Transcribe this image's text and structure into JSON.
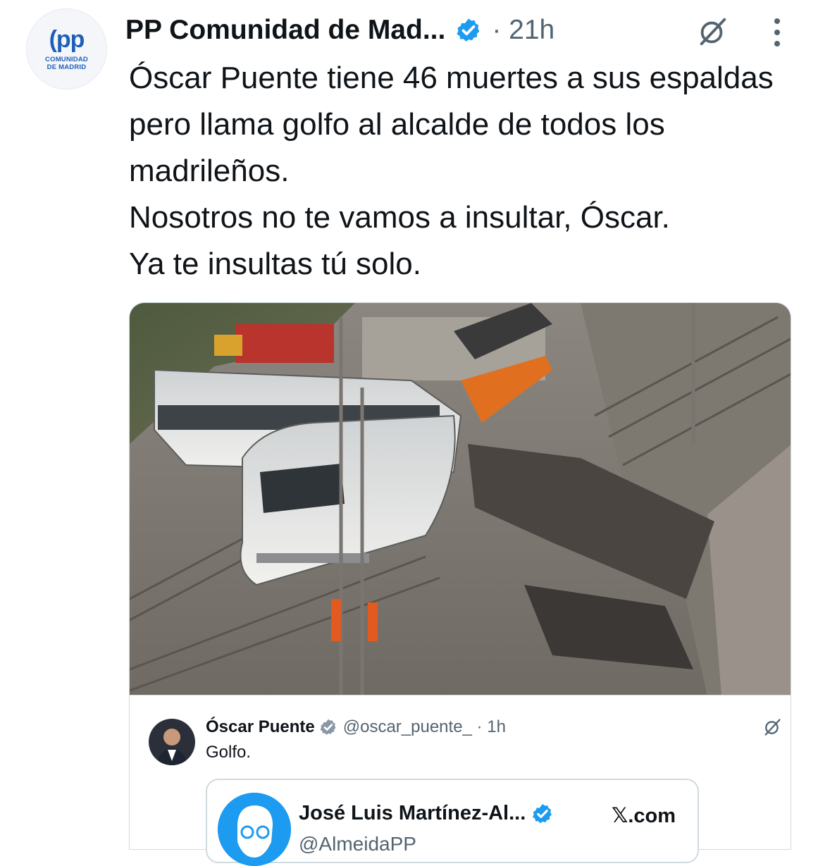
{
  "account": {
    "avatar_text": "pp",
    "avatar_org": "COMUNIDAD\nDE MADRID",
    "display_name": "PP Comunidad de Mad...",
    "time": "· 21h"
  },
  "tweet": {
    "paragraphs": [
      "Óscar Puente tiene 46 muertes a sus espaldas pero llama golfo al alcalde de todos los madrileños.",
      "Nosotros no te vamos a insultar, Óscar.",
      "Ya te insultas tú solo."
    ]
  },
  "quoted": {
    "name": "Óscar Puente",
    "handle_time": "@oscar_puente_ · 1h",
    "text": "Golfo."
  },
  "nested": {
    "name": "José Luis Martínez-Al...",
    "site": "𝕏.com",
    "handle": "@AlmeidaPP"
  },
  "colors": {
    "verified": "#1d9bf0",
    "secondary_text": "#536471",
    "brand_blue": "#1f5fb6"
  },
  "icons": [
    "verified-icon",
    "grok-icon",
    "more-icon"
  ]
}
